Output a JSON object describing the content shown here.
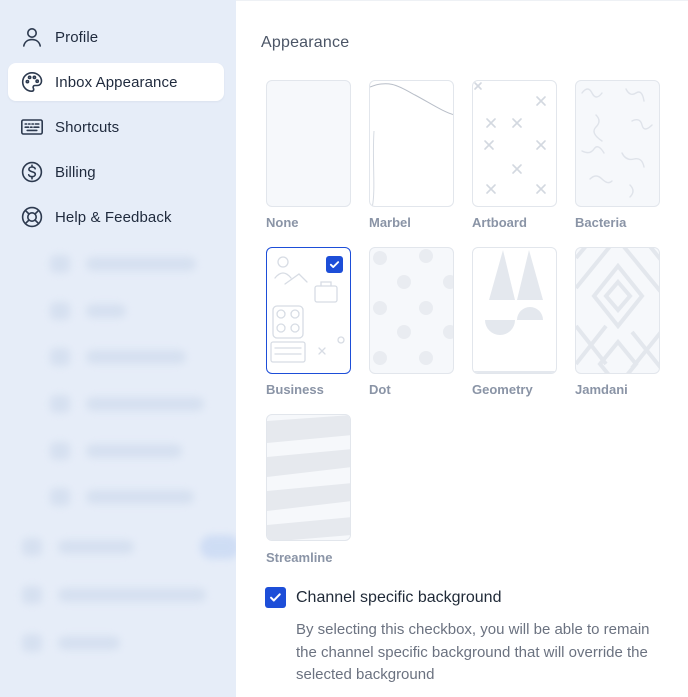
{
  "sidebar": {
    "items": [
      {
        "label": "Profile",
        "icon": "user-icon",
        "active": false
      },
      {
        "label": "Inbox Appearance",
        "icon": "palette-icon",
        "active": true
      },
      {
        "label": "Shortcuts",
        "icon": "keyboard-icon",
        "active": false
      },
      {
        "label": "Billing",
        "icon": "dollar-circle-icon",
        "active": false
      },
      {
        "label": "Help & Feedback",
        "icon": "lifebuoy-icon",
        "active": false
      }
    ]
  },
  "main": {
    "heading": "Appearance",
    "backgrounds": [
      {
        "label": "None",
        "selected": false
      },
      {
        "label": "Marbel",
        "selected": false
      },
      {
        "label": "Artboard",
        "selected": false
      },
      {
        "label": "Bacteria",
        "selected": false
      },
      {
        "label": "Business",
        "selected": true
      },
      {
        "label": "Dot",
        "selected": false
      },
      {
        "label": "Geometry",
        "selected": false
      },
      {
        "label": "Jamdani",
        "selected": false
      },
      {
        "label": "Streamline",
        "selected": false
      }
    ],
    "channel_checkbox": {
      "label": "Channel specific background",
      "checked": true,
      "description": "By selecting this checkbox, you will be able to remain the channel specific background that will override the selected background"
    }
  },
  "colors": {
    "accent": "#1d4ed8",
    "sidebar_bg": "#e6edf8",
    "label_muted": "#8a94a6"
  }
}
